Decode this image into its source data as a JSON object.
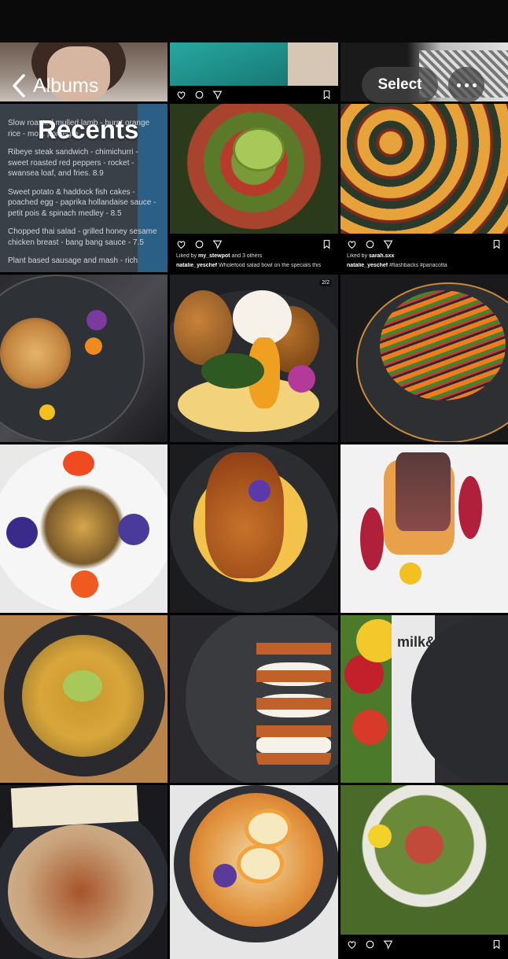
{
  "nav": {
    "back_label": "Albums",
    "title": "Recents",
    "select_label": "Select"
  },
  "icons": {
    "back": "chevron-left-icon",
    "more": "ellipsis-icon",
    "like": "heart-icon",
    "comment": "comment-icon",
    "share": "send-icon",
    "save": "bookmark-icon"
  },
  "menu_post": {
    "items": [
      "Slow roasted mulled lamb - burnt orange rice - mo... pomegra...",
      "Ribeye steak sandwich - chimichurri - sweet roasted red peppers - rocket - swansea loaf, and fries. 8.9",
      "Sweet potato & haddock fish cakes - poached egg - paprika hollandaise sauce - petit pois & spinach medley - 8.5",
      "Chopped thai salad - grilled honey sesame chicken breast - bang bang sauce - 7.5",
      "Plant based sausage and mash - rich"
    ]
  },
  "posts": {
    "salad_bowl": {
      "liked_prefix": "Liked by",
      "liked_user": "my_stewpot",
      "liked_suffix": "and 3 others",
      "caption_user": "natalie_yeschef",
      "caption_text": "Wholefood salad bowl on the specials this"
    },
    "panacotta": {
      "liked_prefix": "Liked by",
      "liked_user": "sarah.sxx",
      "caption_user": "natalie_yeschef",
      "caption_text": "#flashbacks #panacotta"
    },
    "fishcake": {
      "counter": "2/2"
    }
  },
  "signage": {
    "text": "milk& sugar"
  },
  "colors": {
    "background": "#000000",
    "control_bg": "#464646",
    "text": "#ffffff"
  }
}
